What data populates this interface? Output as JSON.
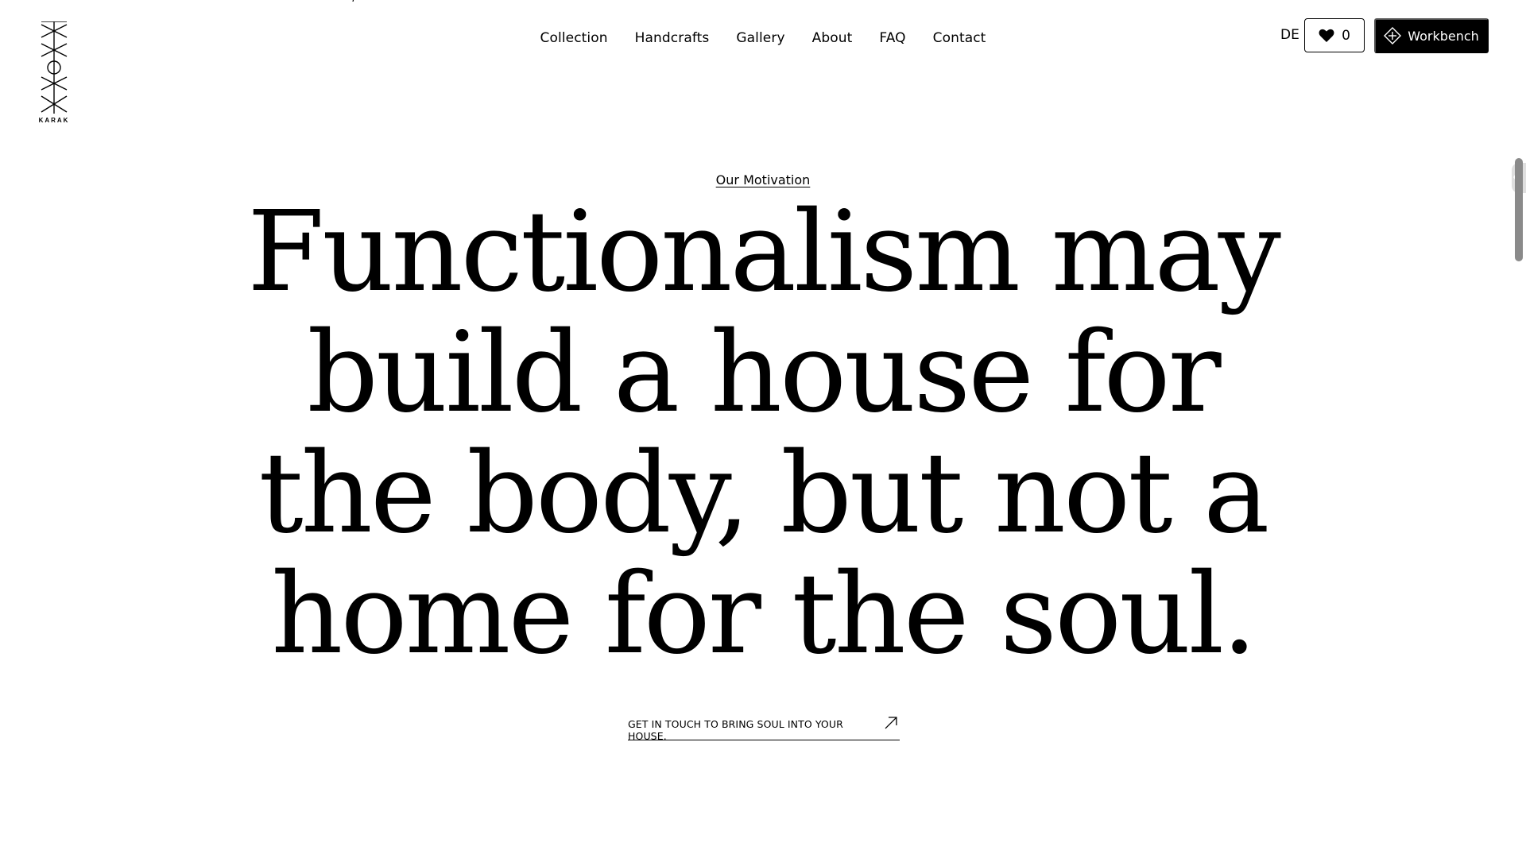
{
  "brand": {
    "logo_text": "KARAK"
  },
  "nav": {
    "items": [
      {
        "label": "Collection"
      },
      {
        "label": "Handcrafts"
      },
      {
        "label": "Gallery"
      },
      {
        "label": "About"
      },
      {
        "label": "FAQ"
      },
      {
        "label": "Contact"
      }
    ]
  },
  "header_controls": {
    "language": "DE",
    "favorites_count": "0",
    "favorites_icon": "heart-icon",
    "workbench_label": "Workbench",
    "workbench_icon": "diamond-plus-icon"
  },
  "hero": {
    "eyebrow": "Our Motivation",
    "headline_lines": [
      "Functionalism may",
      "build a house for",
      "the body, but not a",
      "home for the soul."
    ],
    "cta_label": "GET IN TOUCH TO BRING SOUL INTO YOUR HOUSE.",
    "cta_icon": "arrow-up-right-icon"
  },
  "colors": {
    "background": "#ffffff",
    "text": "#000000",
    "button_dark": "#000000",
    "scrollbar": "#8a8a8a"
  }
}
